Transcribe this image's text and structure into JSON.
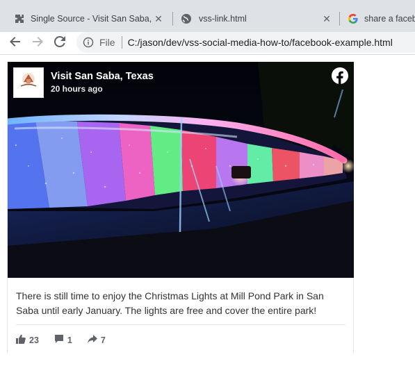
{
  "browser": {
    "tabs": [
      {
        "title": "Single Source - Visit San Saba, Te",
        "favicon": "puzzle-icon",
        "active": false
      },
      {
        "title": "vss-link.html",
        "favicon": "globe-icon",
        "active": true
      },
      {
        "title": "share a facebo",
        "favicon": "google-icon",
        "active": false
      }
    ],
    "close_glyph": "✕",
    "address": {
      "scheme_label": "File",
      "url": "C:/jason/dev/vss-social-media-how-to/facebook-example.html"
    }
  },
  "post": {
    "page_name": "Visit San Saba, Texas",
    "time_ago": "20 hours ago",
    "avatar_text": "San Saba",
    "body": "There is still time to enjoy the Christmas Lights at Mill Pond Park in San Saba until early January. The lights are free and cover the entire park!",
    "stats": {
      "likes": "23",
      "comments": "1",
      "shares": "7"
    }
  },
  "colors": {
    "facebook_blue": "#1877f2",
    "stat_gray": "#5f6368"
  }
}
